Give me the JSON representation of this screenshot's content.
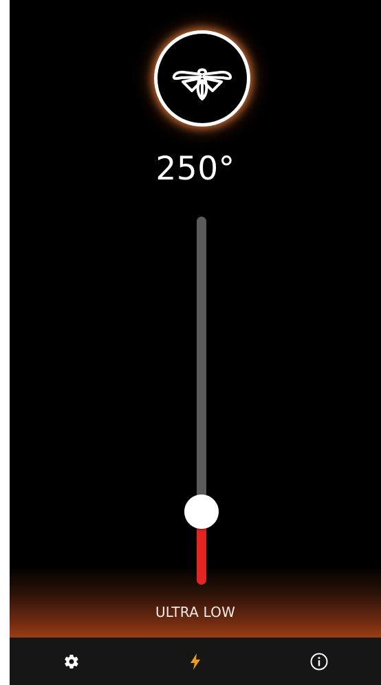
{
  "temperature": {
    "value": 250,
    "display": "250°"
  },
  "slider": {
    "level_fraction": 0.18
  },
  "mode": {
    "label": "ULTRA LOW"
  },
  "tabbar": {
    "items": [
      {
        "icon": "gear-icon",
        "selected": false
      },
      {
        "icon": "lightning-bolt-icon",
        "selected": true
      },
      {
        "icon": "info-icon",
        "selected": false
      }
    ]
  },
  "colors": {
    "background": "#000000",
    "slider_track": "#5b5b5b",
    "slider_fill": "#e52620",
    "accent_active": "#e8a01c",
    "glow": "#9b3d16",
    "tabbar_bg": "#161616"
  }
}
